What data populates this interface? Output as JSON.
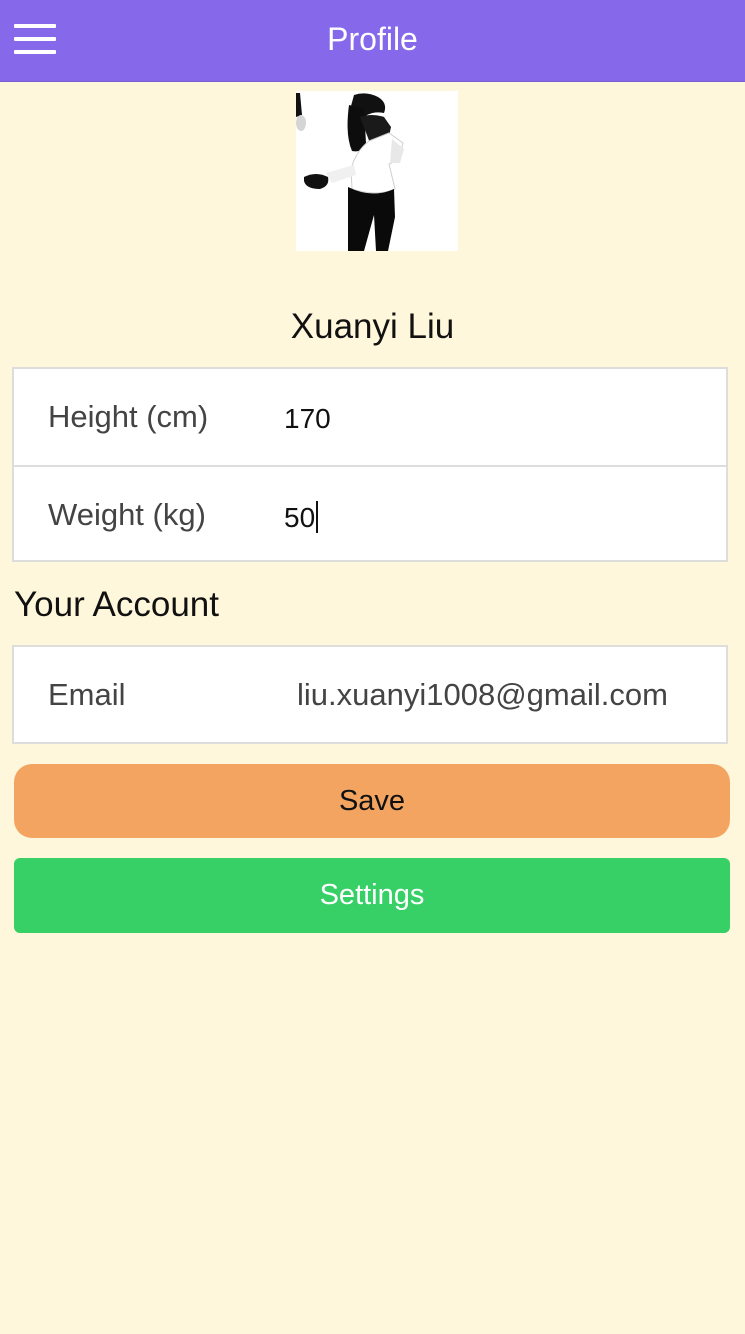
{
  "header": {
    "title": "Profile",
    "menu_icon": "menu-icon",
    "background_color": "#8668ea"
  },
  "profile": {
    "name": "Xuanyi Liu"
  },
  "metrics": {
    "height_label": "Height (cm)",
    "height_value": "170",
    "weight_label": "Weight (kg)",
    "weight_value": "50"
  },
  "account": {
    "section_title": "Your Account",
    "email_label": "Email",
    "email_value": "liu.xuanyi1008@gmail.com"
  },
  "actions": {
    "save_label": "Save",
    "save_color": "#f4a461",
    "settings_label": "Settings",
    "settings_color": "#37d067"
  },
  "theme": {
    "page_background": "#fff7dc"
  }
}
